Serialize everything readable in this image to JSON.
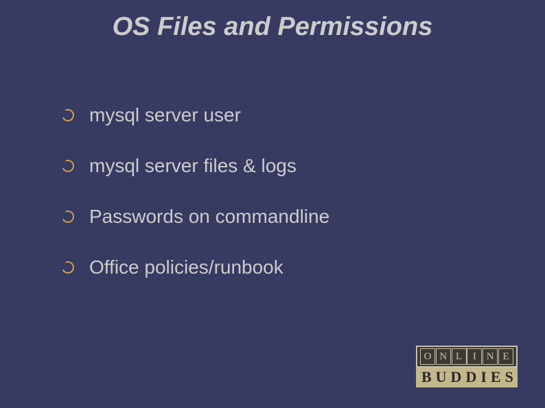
{
  "title": "OS Files and Permissions",
  "bullets": [
    "mysql server user",
    "mysql server files & logs",
    "Passwords on commandline",
    "Office policies/runbook"
  ],
  "logo": {
    "top": [
      "O",
      "N",
      "L",
      "I",
      "N",
      "E"
    ],
    "bottom": "BUDDIES"
  }
}
